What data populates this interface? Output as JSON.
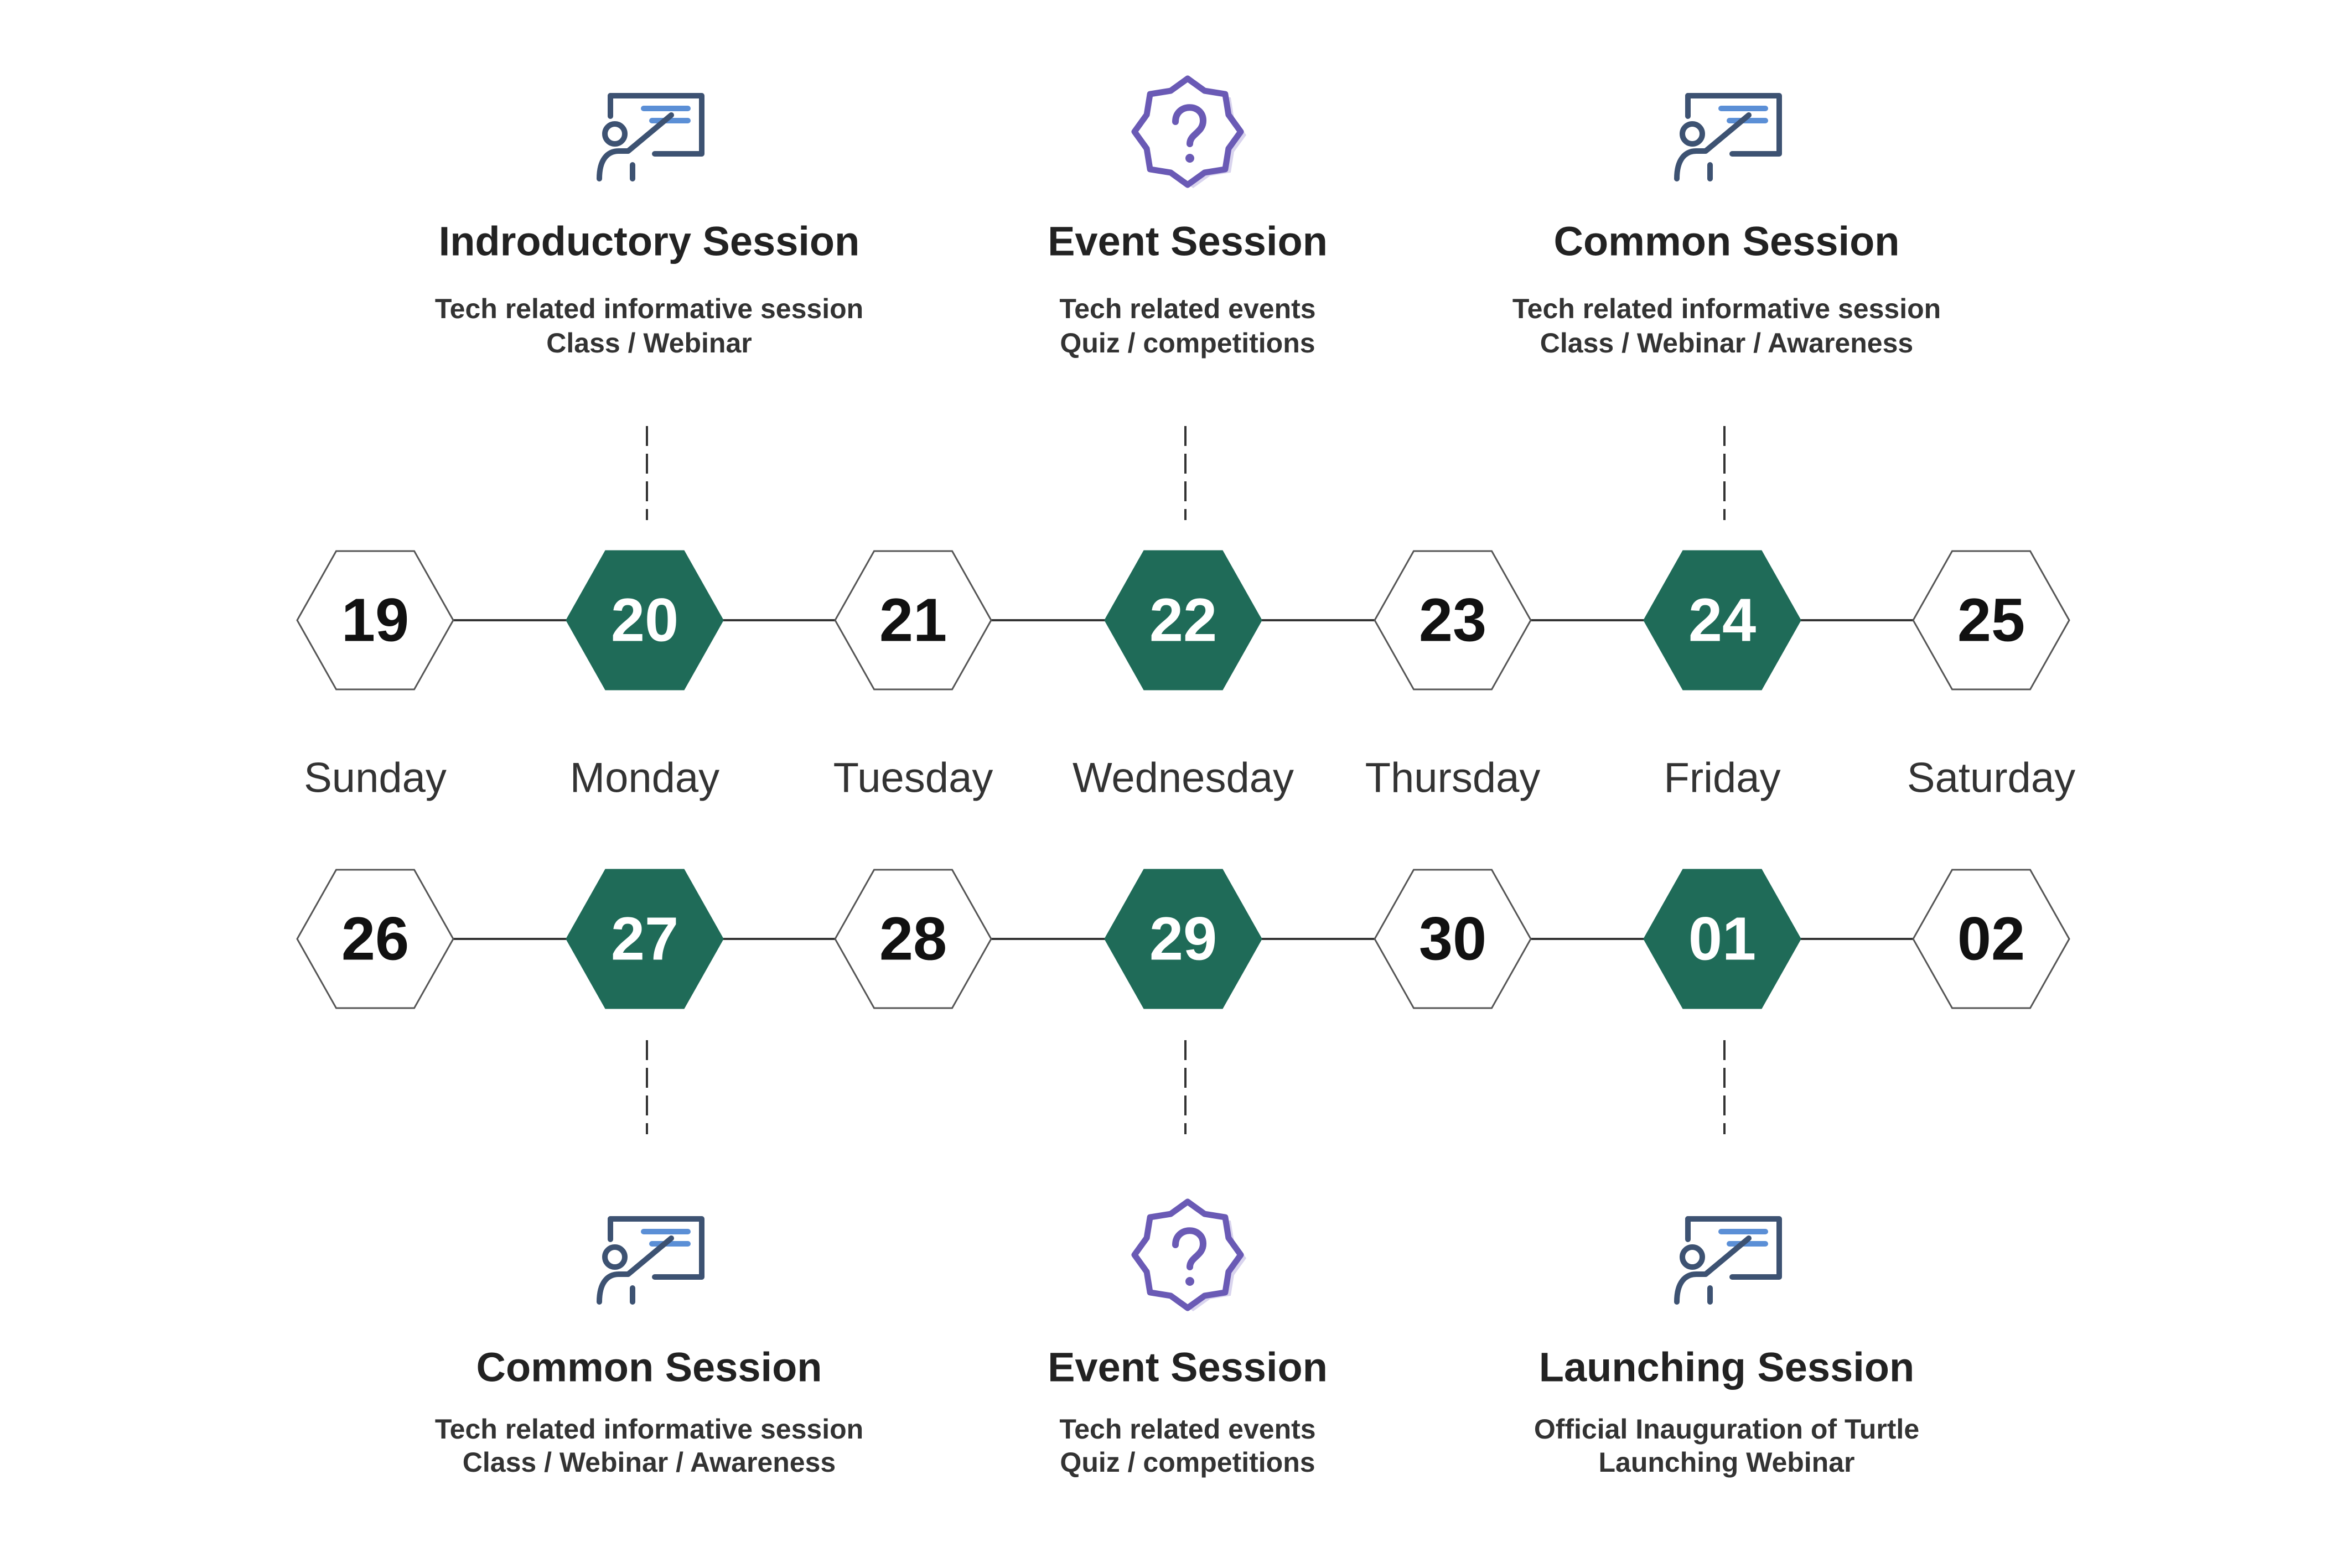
{
  "colors": {
    "accent": "#1f6b58",
    "hex_outline": "#555555",
    "connector": "#333333",
    "icon_navy": "#3d5272",
    "icon_blue": "#5b8fd6",
    "icon_purple": "#6a5ab5",
    "icon_lavender": "#d9d4ee",
    "number_dark": "#111111",
    "number_light": "#ffffff"
  },
  "weekdays": [
    "Sunday",
    "Monday",
    "Tuesday",
    "Wednesday",
    "Thursday",
    "Friday",
    "Saturday"
  ],
  "week1": [
    {
      "num": "19",
      "highlight": false
    },
    {
      "num": "20",
      "highlight": true
    },
    {
      "num": "21",
      "highlight": false
    },
    {
      "num": "22",
      "highlight": true
    },
    {
      "num": "23",
      "highlight": false
    },
    {
      "num": "24",
      "highlight": true
    },
    {
      "num": "25",
      "highlight": false
    }
  ],
  "week2": [
    {
      "num": "26",
      "highlight": false
    },
    {
      "num": "27",
      "highlight": true
    },
    {
      "num": "28",
      "highlight": false
    },
    {
      "num": "29",
      "highlight": true
    },
    {
      "num": "30",
      "highlight": false
    },
    {
      "num": "01",
      "highlight": true
    },
    {
      "num": "02",
      "highlight": false
    }
  ],
  "sessions_top": [
    {
      "day_index": 1,
      "icon": "presentation-icon",
      "title": "Indroductory Session",
      "lines": [
        "Tech related informative session",
        "Class / Webinar"
      ]
    },
    {
      "day_index": 3,
      "icon": "question-badge-icon",
      "title": "Event Session",
      "lines": [
        "Tech related events",
        "Quiz / competitions"
      ]
    },
    {
      "day_index": 5,
      "icon": "presentation-icon",
      "title": "Common Session",
      "lines": [
        "Tech related informative session",
        "Class / Webinar / Awareness"
      ]
    }
  ],
  "sessions_bottom": [
    {
      "day_index": 1,
      "icon": "presentation-icon",
      "title": "Common Session",
      "lines": [
        "Tech related informative session",
        "Class / Webinar / Awareness"
      ]
    },
    {
      "day_index": 3,
      "icon": "question-badge-icon",
      "title": "Event Session",
      "lines": [
        "Tech related events",
        "Quiz / competitions"
      ]
    },
    {
      "day_index": 5,
      "icon": "presentation-icon",
      "title": "Launching Session",
      "lines": [
        "Official Inauguration of Turtle",
        "Launching Webinar"
      ]
    }
  ]
}
